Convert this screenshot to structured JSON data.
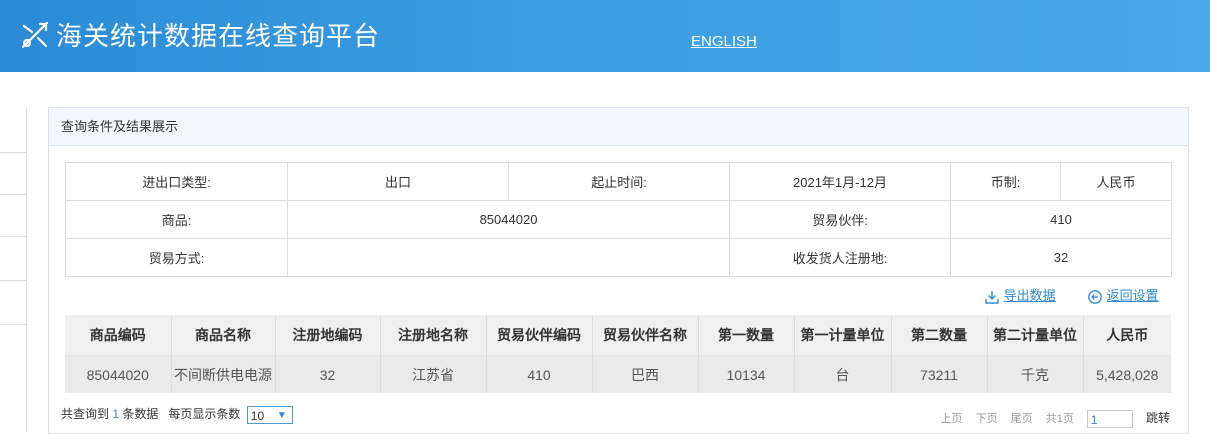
{
  "header": {
    "title": "海关统计数据在线查询平台",
    "lang_link": "ENGLISH"
  },
  "panel": {
    "title": "查询条件及结果展示"
  },
  "conditions": {
    "trade_type_label": "进出口类型:",
    "trade_type_value": "出口",
    "period_label": "起止时间:",
    "period_value": "2021年1月-12月",
    "currency_label": "币制:",
    "currency_value": "人民币",
    "goods_label": "商品:",
    "goods_value": "85044020",
    "partner_label": "贸易伙伴:",
    "partner_value": "410",
    "trade_mode_label": "贸易方式:",
    "trade_mode_value": "",
    "reg_place_label": "收发货人注册地:",
    "reg_place_value": "32"
  },
  "actions": {
    "export_label": "导出数据",
    "back_label": "返回设置"
  },
  "results": {
    "columns": [
      "商品编码",
      "商品名称",
      "注册地编码",
      "注册地名称",
      "贸易伙伴编码",
      "贸易伙伴名称",
      "第一数量",
      "第一计量单位",
      "第二数量",
      "第二计量单位",
      "人民币"
    ],
    "rows": [
      [
        "85044020",
        "不间断供电电源",
        "32",
        "江苏省",
        "410",
        "巴西",
        "10134",
        "台",
        "73211",
        "千克",
        "5,428,028"
      ]
    ]
  },
  "footer": {
    "total_prefix": "共查询到",
    "total_count": "1",
    "total_suffix": "条数据",
    "per_page_label": "每页显示条数",
    "per_page_value": "10",
    "prev": "上页",
    "next": "下页",
    "last": "尾页",
    "total_pages": "共1页",
    "page_input": "1",
    "jump": "跳转"
  },
  "colors": {
    "header_bg": "#3b9be0",
    "accent": "#2e88d0"
  }
}
